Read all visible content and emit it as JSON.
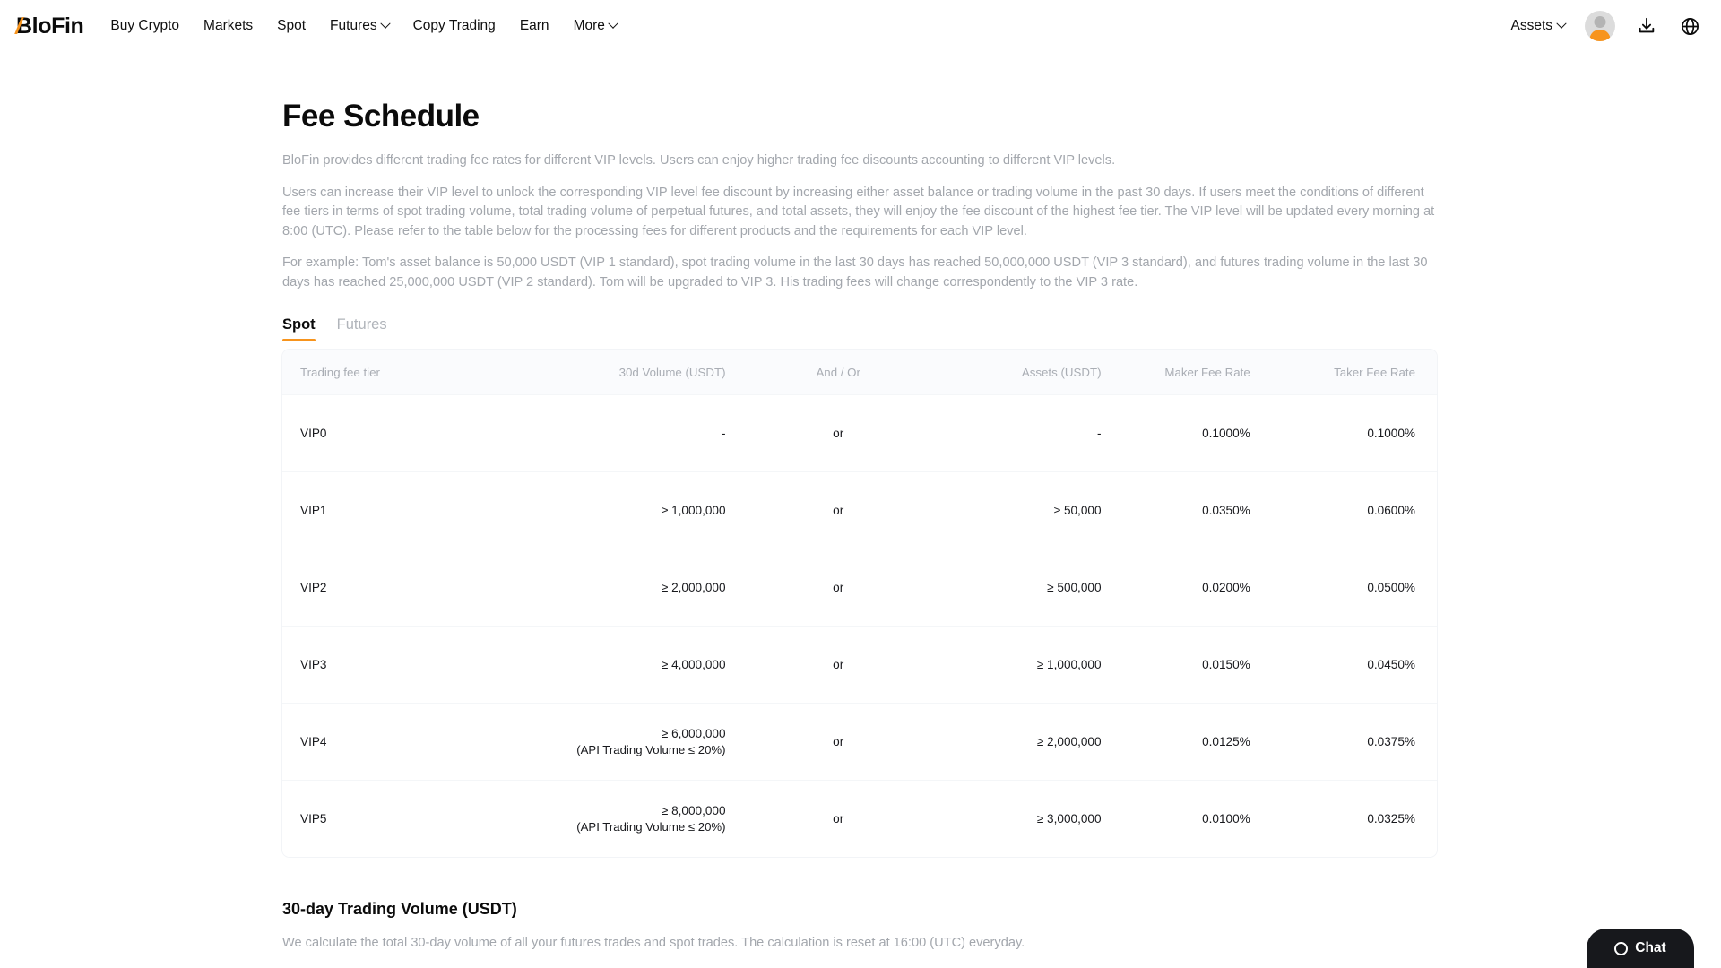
{
  "nav": {
    "logo": "BloFin",
    "links": [
      {
        "label": "Buy Crypto",
        "caret": false
      },
      {
        "label": "Markets",
        "caret": false
      },
      {
        "label": "Spot",
        "caret": false
      },
      {
        "label": "Futures",
        "caret": true
      },
      {
        "label": "Copy Trading",
        "caret": false
      },
      {
        "label": "Earn",
        "caret": false
      },
      {
        "label": "More",
        "caret": true
      }
    ],
    "assets_label": "Assets",
    "icons": [
      "download-icon",
      "globe-icon"
    ]
  },
  "page": {
    "title": "Fee Schedule",
    "paragraphs": [
      "BloFin provides different trading fee rates for different VIP levels. Users can enjoy higher trading fee discounts accounting to different VIP levels.",
      "Users can increase their VIP level to unlock the corresponding VIP level fee discount by increasing either asset balance or trading volume in the past 30 days. If users meet the conditions of different fee tiers in terms of spot trading volume, total trading volume of perpetual futures, and total assets, they will enjoy the fee discount of the highest fee tier. The VIP level will be updated every morning at 8:00 (UTC). Please refer to the table below for the processing fees for different products and the requirements for each VIP level.",
      "For example: Tom's asset balance is 50,000 USDT (VIP 1 standard), spot trading volume in the last 30 days has reached 50,000,000 USDT (VIP 3 standard), and futures trading volume in the last 30 days has reached 25,000,000 USDT (VIP 2 standard). Tom will be upgraded to VIP 3. His trading fees will change correspondently to the VIP 3 rate."
    ]
  },
  "tabs": [
    {
      "label": "Spot",
      "active": true
    },
    {
      "label": "Futures",
      "active": false
    }
  ],
  "table": {
    "headers": [
      "Trading fee tier",
      "30d Volume (USDT)",
      "And / Or",
      "Assets (USDT)",
      "Maker Fee Rate",
      "Taker Fee Rate"
    ],
    "rows": [
      {
        "tier": "VIP0",
        "volume": "-",
        "volume_note": "",
        "andor": "or",
        "assets": "-",
        "maker": "0.1000%",
        "taker": "0.1000%"
      },
      {
        "tier": "VIP1",
        "volume": "≥ 1,000,000",
        "volume_note": "",
        "andor": "or",
        "assets": "≥ 50,000",
        "maker": "0.0350%",
        "taker": "0.0600%"
      },
      {
        "tier": "VIP2",
        "volume": "≥ 2,000,000",
        "volume_note": "",
        "andor": "or",
        "assets": "≥ 500,000",
        "maker": "0.0200%",
        "taker": "0.0500%"
      },
      {
        "tier": "VIP3",
        "volume": "≥ 4,000,000",
        "volume_note": "",
        "andor": "or",
        "assets": "≥ 1,000,000",
        "maker": "0.0150%",
        "taker": "0.0450%"
      },
      {
        "tier": "VIP4",
        "volume": "≥ 6,000,000",
        "volume_note": "(API Trading Volume ≤ 20%)",
        "andor": "or",
        "assets": "≥ 2,000,000",
        "maker": "0.0125%",
        "taker": "0.0375%"
      },
      {
        "tier": "VIP5",
        "volume": "≥ 8,000,000",
        "volume_note": "(API Trading Volume ≤ 20%)",
        "andor": "or",
        "assets": "≥ 3,000,000",
        "maker": "0.0100%",
        "taker": "0.0325%"
      }
    ]
  },
  "footer_section": {
    "title": "30-day Trading Volume (USDT)",
    "description": "We calculate the total 30-day volume of all your futures trades and spot trades. The calculation is reset at 16:00 (UTC) everyday."
  },
  "chat": {
    "label": "Chat"
  },
  "colors": {
    "accent": "#f7941d",
    "text": "#0b0b0b",
    "muted": "#a3a7ad",
    "chat_bg": "#17181c"
  }
}
